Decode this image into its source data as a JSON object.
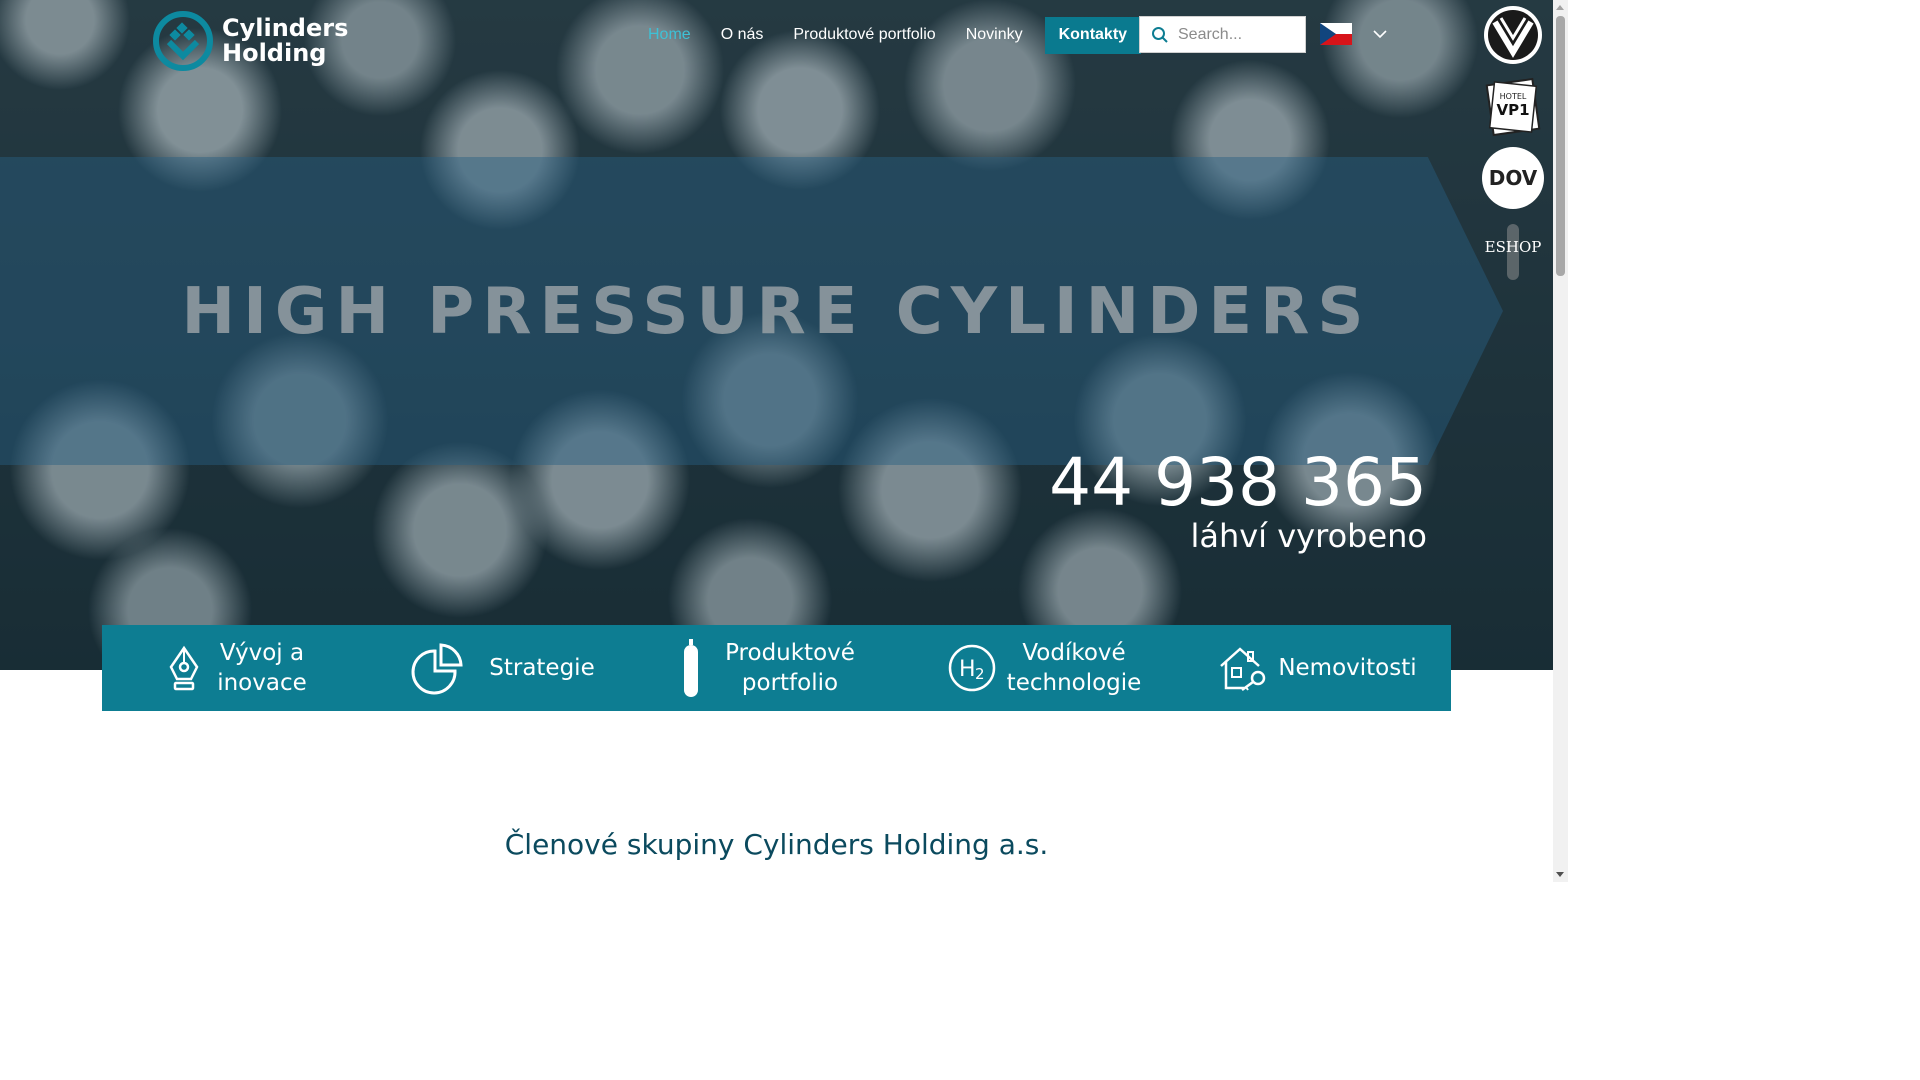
{
  "header": {
    "logo_line1": "Cylinders",
    "logo_line2": "Holding",
    "nav": [
      {
        "label": "Home",
        "active": true
      },
      {
        "label": "O nás",
        "active": false
      },
      {
        "label": "Produktové portfolio",
        "active": false
      },
      {
        "label": "Novinky",
        "active": false
      }
    ],
    "cta_label": "Kontakty",
    "search_placeholder": "Search...",
    "language": "CZ"
  },
  "hero": {
    "banner_text": "HIGH PRESSURE CYLINDERS",
    "counter_value": "44 938 365",
    "counter_label": "láhví vyrobeno"
  },
  "features": [
    {
      "label_line1": "Vývoj a",
      "label_line2": "inovace",
      "icon": "pen-nib-icon"
    },
    {
      "label_line1": "Strategie",
      "label_line2": "",
      "icon": "pie-chart-icon"
    },
    {
      "label_line1": "Produktové",
      "label_line2": "portfolio",
      "icon": "gas-cylinder-icon"
    },
    {
      "label_line1": "Vodíkové",
      "label_line2": "technologie",
      "icon": "h2-icon"
    },
    {
      "label_line1": "Nemovitosti",
      "label_line2": "",
      "icon": "house-key-icon"
    }
  ],
  "rail": {
    "vp1_hotel": "HOTEL",
    "vp1_name": "VP1",
    "dov": "DOV",
    "eshop": "ESHOP"
  },
  "section": {
    "title": "Členové skupiny Cylinders Holding a.s."
  },
  "colors": {
    "accent": "#0d7d92",
    "nav_active": "#3ec1d6",
    "title": "#0b4a5e"
  }
}
